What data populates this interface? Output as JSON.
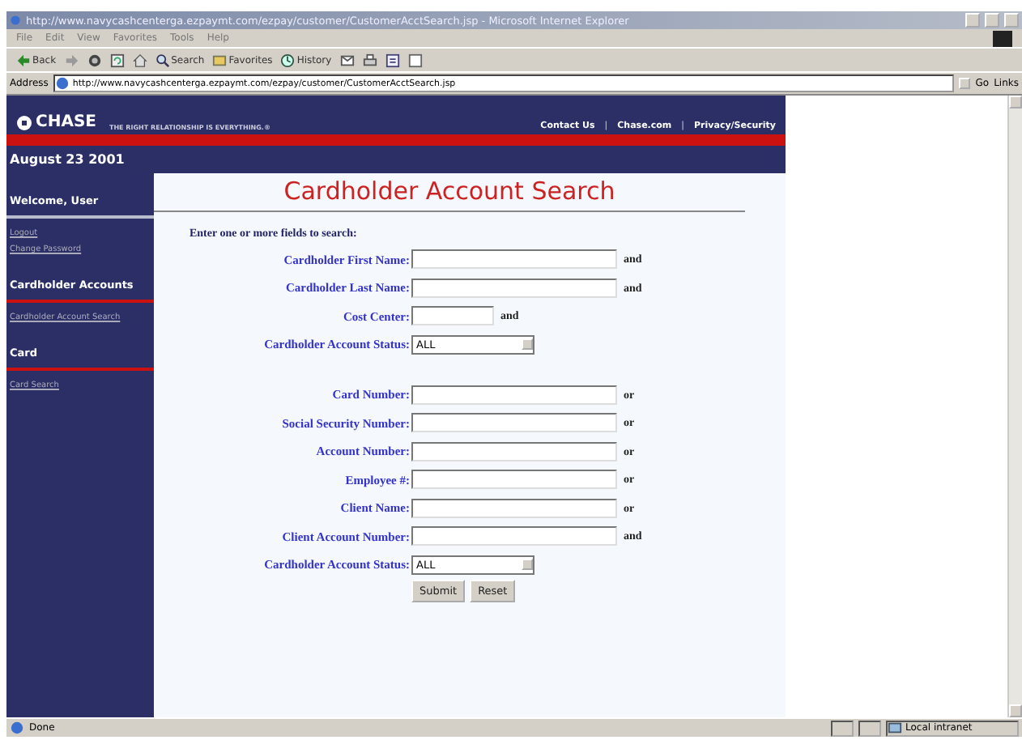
{
  "browser": {
    "title": "http://www.navycashcenterga.ezpaymt.com/ezpay/customer/CustomerAcctSearch.jsp - Microsoft Internet Explorer",
    "menu": [
      "File",
      "Edit",
      "View",
      "Favorites",
      "Tools",
      "Help"
    ],
    "toolbar": [
      {
        "kind": "back",
        "label": "Back"
      },
      {
        "kind": "forward"
      },
      {
        "kind": "stop"
      },
      {
        "kind": "refresh"
      },
      {
        "kind": "home"
      },
      {
        "kind": "search",
        "label": "Search"
      },
      {
        "kind": "favorites",
        "label": "Favorites"
      },
      {
        "kind": "history",
        "label": "History"
      },
      {
        "kind": "mail"
      },
      {
        "kind": "print"
      },
      {
        "kind": "edit"
      },
      {
        "kind": "discuss"
      }
    ],
    "address_label": "Address",
    "url": "http://www.navycashcenterga.ezpaymt.com/ezpay/customer/CustomerAcctSearch.jsp",
    "go": "Go",
    "links": "Links",
    "status": "Done",
    "zone": "Local intranet"
  },
  "page": {
    "logo": "CHASE",
    "tagline": "THE RIGHT RELATIONSHIP IS EVERYTHING.®",
    "top_nav": [
      {
        "kind": "link",
        "text": "Contact Us"
      },
      {
        "kind": "separator",
        "text": "|"
      },
      {
        "kind": "link",
        "text": "Chase.com"
      },
      {
        "kind": "separator",
        "text": "|"
      },
      {
        "kind": "link",
        "text": "Privacy/Security"
      }
    ],
    "date": "August 23 2001",
    "sidebar": [
      {
        "heading": "Welcome, User",
        "color": "#b8bccc",
        "links": [
          "Logout",
          "Change Password"
        ]
      },
      {
        "heading": "Cardholder Accounts",
        "color": "#cc1111",
        "links": [
          "Cardholder Account Search"
        ]
      },
      {
        "heading": "Card",
        "color": "#cc1111",
        "links": [
          "Card Search"
        ]
      }
    ],
    "form": {
      "title": "Cardholder Account Search",
      "instruction": "Enter one or more fields to search:",
      "rows": [
        {
          "kind": "field",
          "label": "Cardholder First Name:",
          "conjunction": "and"
        },
        {
          "kind": "field",
          "label": "Cardholder Last Name:",
          "conjunction": "and"
        },
        {
          "kind": "short-field",
          "label": "Cost Center:",
          "conjunction": "and"
        },
        {
          "kind": "select",
          "label": "Cardholder Account Status:",
          "value": "ALL"
        },
        {
          "kind": "gap"
        },
        {
          "kind": "field",
          "label": "Card Number:",
          "conjunction": "or"
        },
        {
          "kind": "field",
          "label": "Social Security Number:",
          "conjunction": "or"
        },
        {
          "kind": "field",
          "label": "Account Number:",
          "conjunction": "or"
        },
        {
          "kind": "field",
          "label": "Employee #:",
          "conjunction": "or"
        },
        {
          "kind": "field",
          "label": "Client Name:",
          "conjunction": "or"
        },
        {
          "kind": "field",
          "label": "Client Account Number:",
          "conjunction": "and"
        },
        {
          "kind": "select",
          "label": "Cardholder Account Status:",
          "value": "ALL"
        }
      ],
      "buttons": [
        "Submit",
        "Reset"
      ]
    }
  }
}
